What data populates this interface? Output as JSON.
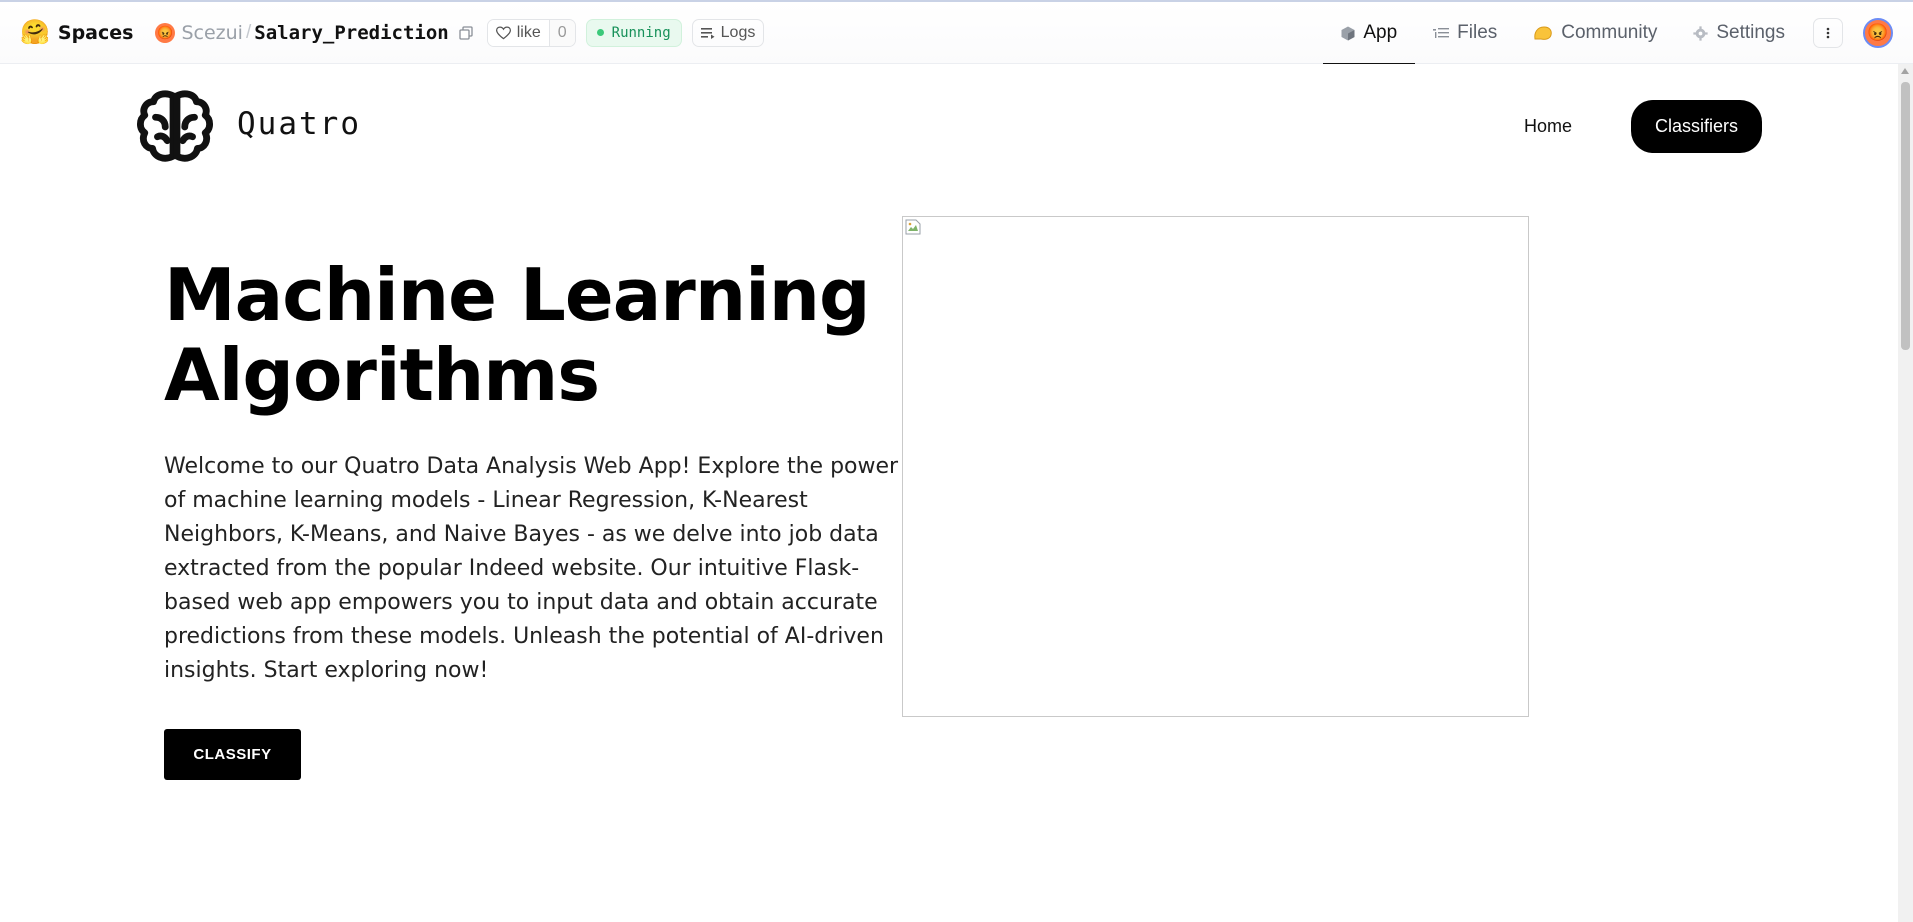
{
  "topbar": {
    "brand": "Spaces",
    "owner": "Scezui",
    "separator": "/",
    "repo": "Salary_Prediction",
    "like_label": "like",
    "like_count": "0",
    "status": "Running",
    "logs_label": "Logs",
    "tabs": [
      {
        "label": "App",
        "icon": "cube-icon",
        "active": true
      },
      {
        "label": "Files",
        "icon": "files-icon",
        "active": false
      },
      {
        "label": "Community",
        "icon": "community-icon",
        "active": false
      },
      {
        "label": "Settings",
        "icon": "gear-icon",
        "active": false
      }
    ]
  },
  "site": {
    "brand": "Quatro",
    "nav": {
      "home": "Home",
      "classifiers": "Classifiers"
    },
    "hero_title_line1": "Machine Learning",
    "hero_title_line2": "Algorithms",
    "hero_text": "Welcome to our Quatro Data Analysis Web App! Explore the power of machine learning models - Linear Regression, K-Nearest Neighbors, K-Means, and Naive Bayes - as we delve into job data extracted from the popular Indeed website. Our intuitive Flask-based web app empowers you to input data and obtain accurate predictions from these models. Unleash the potential of AI-driven insights. Start exploring now!",
    "cta": "CLASSIFY"
  },
  "colors": {
    "running_bg": "#e9f9ef",
    "running_text": "#17915a",
    "primary_button": "#000000",
    "avatar": "#ff7a45"
  }
}
